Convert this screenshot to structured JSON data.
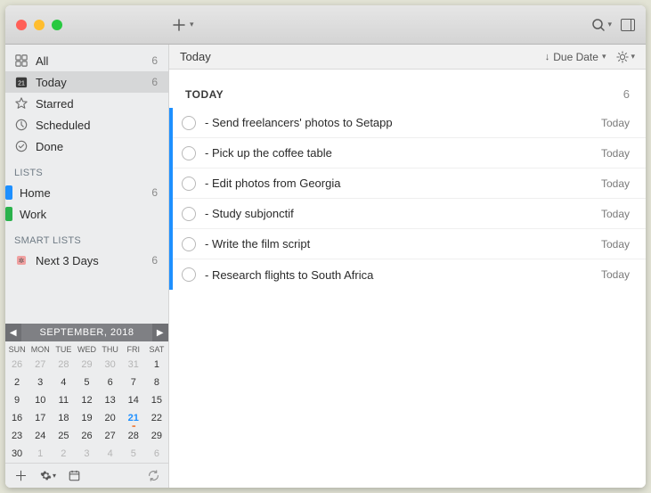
{
  "header": {
    "title": "Today",
    "sort_label": "Due Date"
  },
  "group": {
    "label": "TODAY",
    "count": "6"
  },
  "sidebar": {
    "nav": [
      {
        "label": "All",
        "count": "6"
      },
      {
        "label": "Today",
        "count": "6"
      },
      {
        "label": "Starred",
        "count": ""
      },
      {
        "label": "Scheduled",
        "count": ""
      },
      {
        "label": "Done",
        "count": ""
      }
    ],
    "lists_label": "LISTS",
    "lists": [
      {
        "label": "Home",
        "count": "6"
      },
      {
        "label": "Work",
        "count": ""
      }
    ],
    "smart_label": "SMART LISTS",
    "smart": [
      {
        "label": "Next 3 Days",
        "count": "6"
      }
    ]
  },
  "calendar": {
    "month_label": "SEPTEMBER, 2018",
    "dow": [
      "SUN",
      "MON",
      "TUE",
      "WED",
      "THU",
      "FRI",
      "SAT"
    ],
    "weeks": [
      [
        {
          "d": "26",
          "o": true
        },
        {
          "d": "27",
          "o": true
        },
        {
          "d": "28",
          "o": true
        },
        {
          "d": "29",
          "o": true
        },
        {
          "d": "30",
          "o": true
        },
        {
          "d": "31",
          "o": true
        },
        {
          "d": "1"
        }
      ],
      [
        {
          "d": "2"
        },
        {
          "d": "3"
        },
        {
          "d": "4"
        },
        {
          "d": "5"
        },
        {
          "d": "6"
        },
        {
          "d": "7"
        },
        {
          "d": "8"
        }
      ],
      [
        {
          "d": "9"
        },
        {
          "d": "10"
        },
        {
          "d": "11"
        },
        {
          "d": "12"
        },
        {
          "d": "13"
        },
        {
          "d": "14"
        },
        {
          "d": "15"
        }
      ],
      [
        {
          "d": "16"
        },
        {
          "d": "17"
        },
        {
          "d": "18"
        },
        {
          "d": "19"
        },
        {
          "d": "20"
        },
        {
          "d": "21",
          "t": true
        },
        {
          "d": "22"
        }
      ],
      [
        {
          "d": "23"
        },
        {
          "d": "24"
        },
        {
          "d": "25"
        },
        {
          "d": "26"
        },
        {
          "d": "27"
        },
        {
          "d": "28"
        },
        {
          "d": "29"
        }
      ],
      [
        {
          "d": "30"
        },
        {
          "d": "1",
          "o": true
        },
        {
          "d": "2",
          "o": true
        },
        {
          "d": "3",
          "o": true
        },
        {
          "d": "4",
          "o": true
        },
        {
          "d": "5",
          "o": true
        },
        {
          "d": "6",
          "o": true
        }
      ]
    ]
  },
  "tasks": [
    {
      "title": "- Send freelancers' photos to Setapp",
      "due": "Today"
    },
    {
      "title": "- Pick up the coffee table",
      "due": "Today"
    },
    {
      "title": "- Edit photos from Georgia",
      "due": "Today"
    },
    {
      "title": "- Study subjonctif",
      "due": "Today"
    },
    {
      "title": "- Write the film script",
      "due": "Today"
    },
    {
      "title": "- Research flights to South Africa",
      "due": "Today"
    }
  ]
}
